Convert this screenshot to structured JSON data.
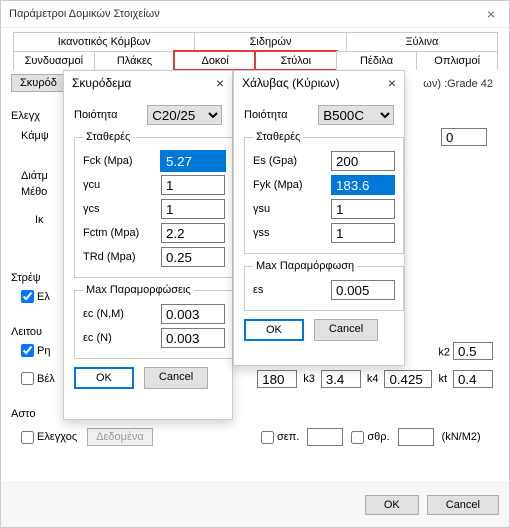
{
  "window": {
    "title": "Παράμετροι Δομικών Στοιχείων"
  },
  "tabs": {
    "row1": [
      "Ικανοτικός Κόμβων",
      "Σιδηρών",
      "Ξύλινα"
    ],
    "row2": [
      "Συνδυασμοί",
      "Πλάκες",
      "Δοκοί",
      "Στύλοι",
      "Πέδιλα",
      "Οπλισμοί"
    ]
  },
  "bg": {
    "skyr_btn": "Σκυρόδ",
    "grade_label": "ων) :Grade 42",
    "elegx": "Ελεγχ",
    "kamp": "Κάμψ",
    "zero": "0",
    "diatm": "Διάτμ",
    "metho": "Μέθο",
    "ik": "Ικ",
    "stref": "Στρέψ",
    "el_check": "Ελ",
    "leitou": "Λειτου",
    "rn": "Ρη",
    "bel": "Βέλ",
    "k2_lbl": "k2",
    "k2_val": "0.5",
    "r180": "180",
    "k3_lbl": "k3",
    "k3_val": "3.4",
    "k4_lbl": "k4",
    "k4_val": "0.425",
    "kt_lbl": "kt",
    "kt_val": "0.4",
    "asto": "Αστο",
    "elegxos": "Ελεγχος",
    "dedomena": "Δεδομένα",
    "sep": "σεπ.",
    "sthr": "σθρ.",
    "unit": "(kN/M2)"
  },
  "footer": {
    "ok": "OK",
    "cancel": "Cancel"
  },
  "panel1": {
    "title": "Σκυρόδεμα",
    "quality_lbl": "Ποιότητα",
    "quality_val": "C20/25",
    "constants": "Σταθερές",
    "fck_lbl": "Fck (Mpa)",
    "fck_val": "5.27",
    "ycu_lbl": "γcu",
    "ycu_val": "1",
    "ycs_lbl": "γcs",
    "ycs_val": "1",
    "fctm_lbl": "Fctm (Mpa)",
    "fctm_val": "2.2",
    "trd_lbl": "TRd (Mpa)",
    "trd_val": "0.25",
    "maxdef": "Max Παραμορφώσεις",
    "ecnm_lbl": "εc (N,M)",
    "ecnm_val": "0.003",
    "ecn_lbl": "εc (N)",
    "ecn_val": "0.003",
    "ok": "OK",
    "cancel": "Cancel"
  },
  "panel2": {
    "title": "Χάλυβας (Κύριων)",
    "quality_lbl": "Ποιότητα",
    "quality_val": "B500C",
    "constants": "Σταθερές",
    "es_lbl": "Es (Gpa)",
    "es_val": "200",
    "fyk_lbl": "Fyk (Mpa)",
    "fyk_val": "183.6",
    "ysu_lbl": "γsu",
    "ysu_val": "1",
    "yss_lbl": "γss",
    "yss_val": "1",
    "maxdef": "Max Παραμόρφωση",
    "eps_lbl": "εs",
    "eps_val": "0.005",
    "ok": "OK",
    "cancel": "Cancel"
  }
}
